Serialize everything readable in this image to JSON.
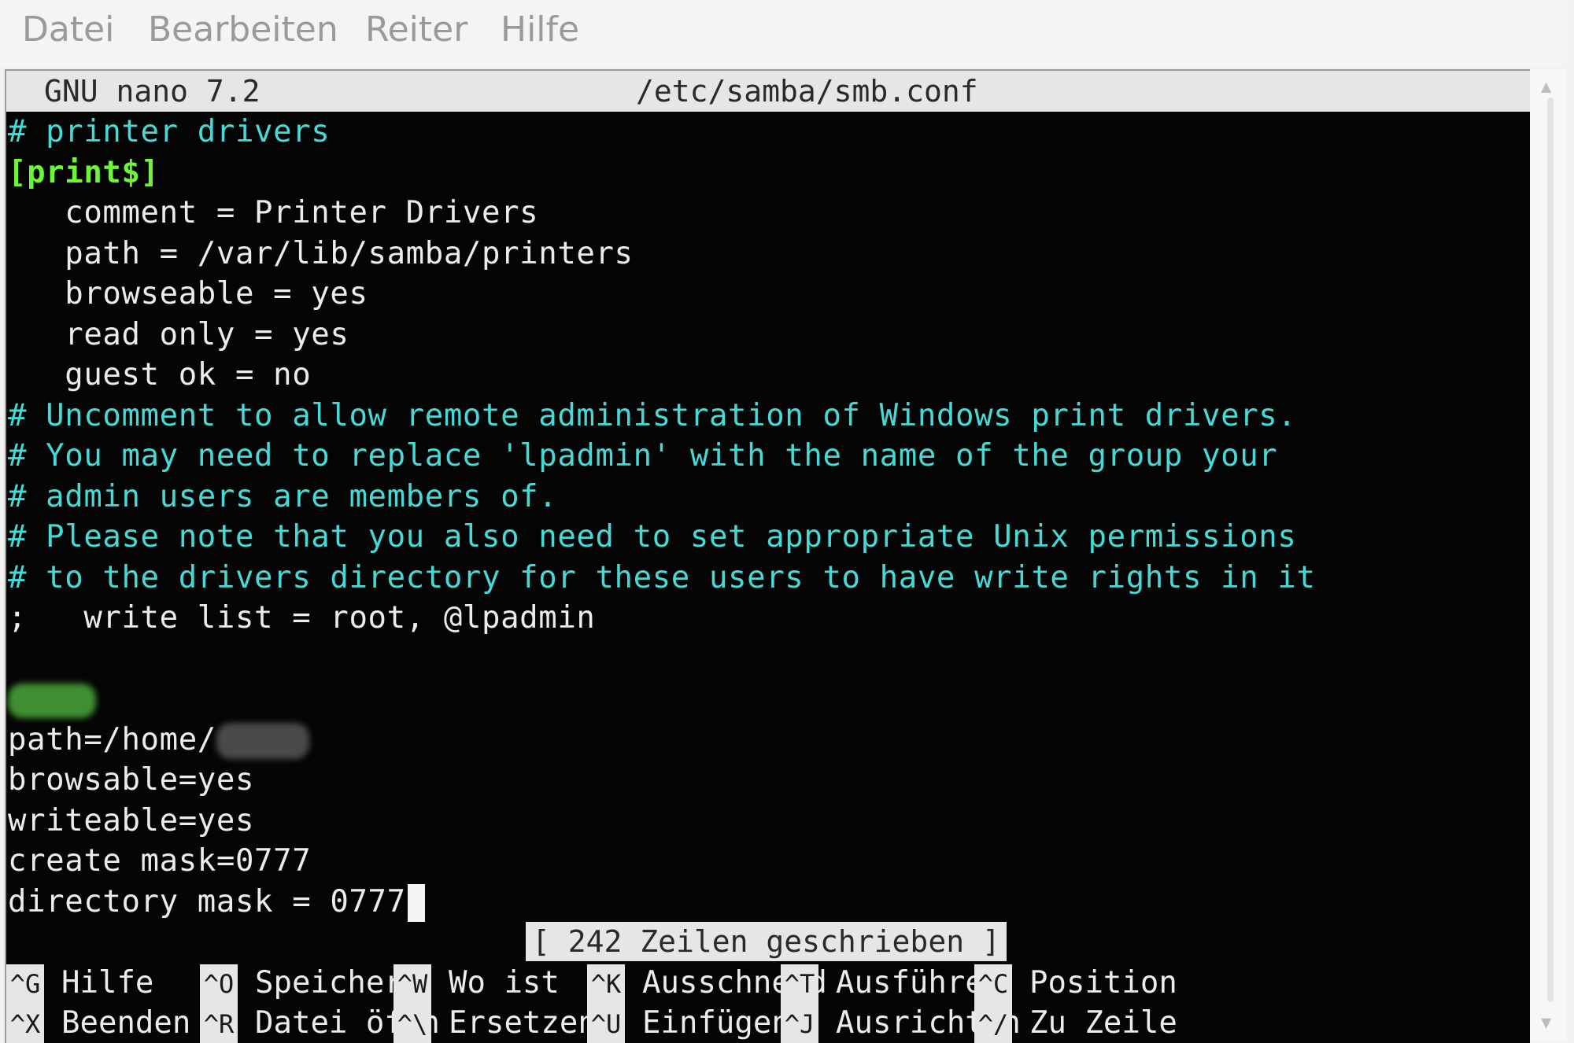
{
  "menu": [
    "Datei",
    "Bearbeiten",
    "Reiter",
    "Hilfe"
  ],
  "nano": {
    "version_label": "GNU nano 7.2",
    "filename": "/etc/samba/smb.conf"
  },
  "lines": [
    {
      "text": "# printer drivers",
      "kind": "comment"
    },
    {
      "text": "[print$]",
      "kind": "section"
    },
    {
      "text": "   comment = Printer Drivers",
      "kind": "normal"
    },
    {
      "text": "   path = /var/lib/samba/printers",
      "kind": "normal"
    },
    {
      "text": "   browseable = yes",
      "kind": "normal"
    },
    {
      "text": "   read only = yes",
      "kind": "normal"
    },
    {
      "text": "   guest ok = no",
      "kind": "normal"
    },
    {
      "text": "# Uncomment to allow remote administration of Windows print drivers.",
      "kind": "comment"
    },
    {
      "text": "# You may need to replace 'lpadmin' with the name of the group your",
      "kind": "comment"
    },
    {
      "text": "# admin users are members of.",
      "kind": "comment"
    },
    {
      "text": "# Please note that you also need to set appropriate Unix permissions",
      "kind": "comment"
    },
    {
      "text": "# to the drivers directory for these users to have write rights in it",
      "kind": "comment"
    },
    {
      "text": ";   write list = root, @lpadmin",
      "kind": "normal"
    },
    {
      "text": "",
      "kind": "normal"
    },
    {
      "text": "",
      "kind": "section_redacted"
    },
    {
      "text": "path=/home/",
      "kind": "path_redacted"
    },
    {
      "text": "browsable=yes",
      "kind": "normal"
    },
    {
      "text": "writeable=yes",
      "kind": "normal"
    },
    {
      "text": "create mask=0777",
      "kind": "normal"
    },
    {
      "text": "directory mask = 0777",
      "kind": "cursor"
    }
  ],
  "status_message": "[ 242 Zeilen geschrieben ]",
  "shortcuts": [
    {
      "key": "^G",
      "label": "Hilfe"
    },
    {
      "key": "^O",
      "label": "Speichern"
    },
    {
      "key": "^W",
      "label": "Wo ist"
    },
    {
      "key": "^K",
      "label": "Ausschneid"
    },
    {
      "key": "^T",
      "label": "Ausführen"
    },
    {
      "key": "^C",
      "label": "Position"
    },
    {
      "key": "^X",
      "label": "Beenden"
    },
    {
      "key": "^R",
      "label": "Datei öffn"
    },
    {
      "key": "^\\",
      "label": "Ersetzen"
    },
    {
      "key": "^U",
      "label": "Einfügen"
    },
    {
      "key": "^J",
      "label": "Ausrichten"
    },
    {
      "key": "^/",
      "label": "Zu Zeile"
    }
  ],
  "colors": {
    "comment": "#46d9d5",
    "section": "#6cf53b",
    "text": "#ececec",
    "background": "#050505"
  }
}
